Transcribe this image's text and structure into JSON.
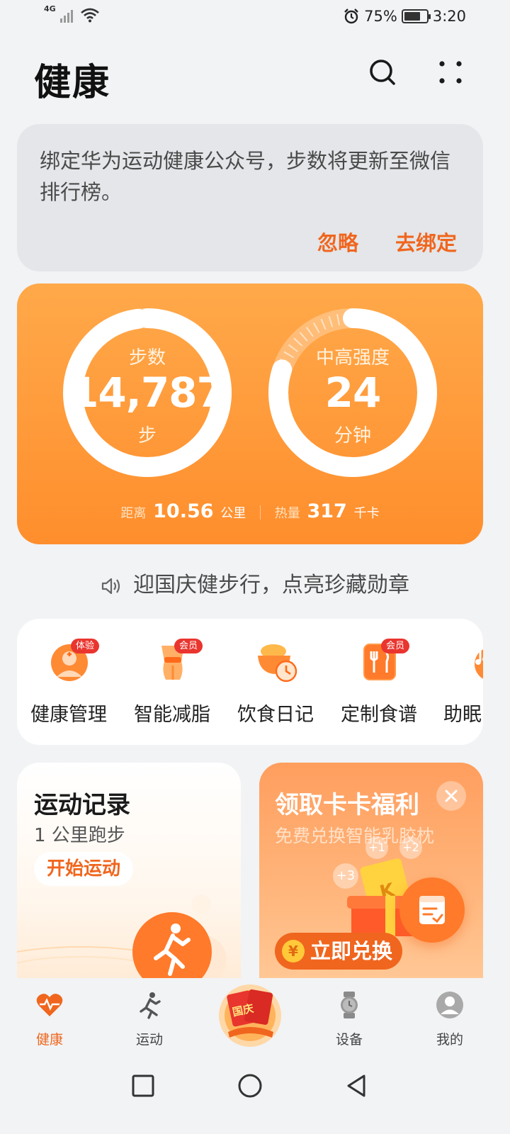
{
  "status_bar": {
    "network": "4G",
    "battery_percent": "75%",
    "battery_level": 0.75,
    "time": "3:20",
    "icons": [
      "signal-icon",
      "wifi-icon",
      "alarm-icon",
      "battery-icon"
    ]
  },
  "header": {
    "title": "健康",
    "icons": [
      "search-icon",
      "more-icon"
    ]
  },
  "bind_card": {
    "message": "绑定华为运动健康公众号，步数将更新至微信排行榜。",
    "ignore_label": "忽略",
    "bind_label": "去绑定"
  },
  "activity": {
    "steps": {
      "label": "步数",
      "value": "14,787",
      "unit": "步",
      "ring_progress": 0.98
    },
    "intensity": {
      "label": "中高强度",
      "value": "24",
      "unit": "分钟",
      "ring_progress": 0.8
    },
    "distance": {
      "label": "距离",
      "value": "10.56",
      "unit": "公里"
    },
    "calories": {
      "label": "热量",
      "value": "317",
      "unit": "千卡"
    }
  },
  "announcement": {
    "text": "迎国庆健步行，点亮珍藏勋章",
    "icon": "speaker-icon"
  },
  "services": [
    {
      "label": "健康管理",
      "badge": "体验",
      "icon": "health-manage-icon"
    },
    {
      "label": "智能减脂",
      "badge": "会员",
      "icon": "fat-loss-icon"
    },
    {
      "label": "饮食日记",
      "badge": "",
      "icon": "diet-diary-icon"
    },
    {
      "label": "定制食谱",
      "badge": "会员",
      "icon": "recipe-icon"
    },
    {
      "label": "助眠",
      "badge": "",
      "icon": "sleep-aid-icon"
    }
  ],
  "exercise_card": {
    "title": "运动记录",
    "subtitle": "1 公里跑步",
    "button": "开始运动",
    "icon": "running-icon"
  },
  "benefit_card": {
    "title": "领取卡卡福利",
    "subtitle": "免费兑换智能乳胶枕",
    "button": "立即兑换",
    "tags": [
      "+3",
      "+1",
      "+2"
    ],
    "icons": [
      "close-icon",
      "gift-icon",
      "coin-icon"
    ]
  },
  "fab": {
    "icon": "checklist-icon"
  },
  "bottom_nav": [
    {
      "label": "健康",
      "icon": "heart-pulse-icon",
      "active": true
    },
    {
      "label": "运动",
      "icon": "runner-icon",
      "active": false
    },
    {
      "label": "国庆",
      "icon": "national-day-icon",
      "active": false
    },
    {
      "label": "设备",
      "icon": "watch-icon",
      "active": false
    },
    {
      "label": "我的",
      "icon": "profile-icon",
      "active": false
    }
  ],
  "system_nav": [
    "recent-apps-icon",
    "home-icon",
    "back-icon"
  ],
  "colors": {
    "accent": "#F0661E",
    "card_orange": "#FF9A3A",
    "background": "#F1F3F5",
    "badge_red": "#E9352E"
  }
}
